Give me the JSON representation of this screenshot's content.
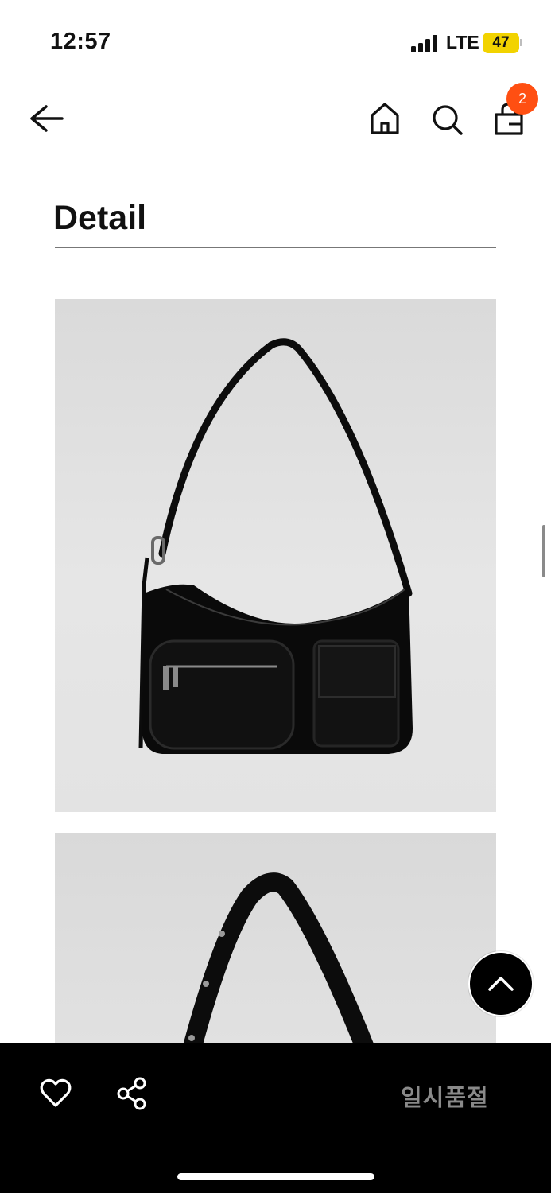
{
  "status_bar": {
    "time": "12:57",
    "network": "LTE",
    "battery": "47",
    "battery_color": "#f2d300"
  },
  "header": {
    "icons": [
      "back-arrow-icon",
      "home-icon",
      "search-icon",
      "shopping-bag-icon"
    ],
    "cart_count": "2",
    "badge_color": "#ff4f12"
  },
  "detail": {
    "title": "Detail"
  },
  "images": [
    {
      "subject": "black shoulder bag front view",
      "icon": "product-image"
    },
    {
      "subject": "black shoulder bag strap close-up",
      "icon": "product-image"
    }
  ],
  "bottom_bar": {
    "icons": [
      "heart-icon",
      "share-icon"
    ],
    "sold_out_label": "일시품절"
  }
}
